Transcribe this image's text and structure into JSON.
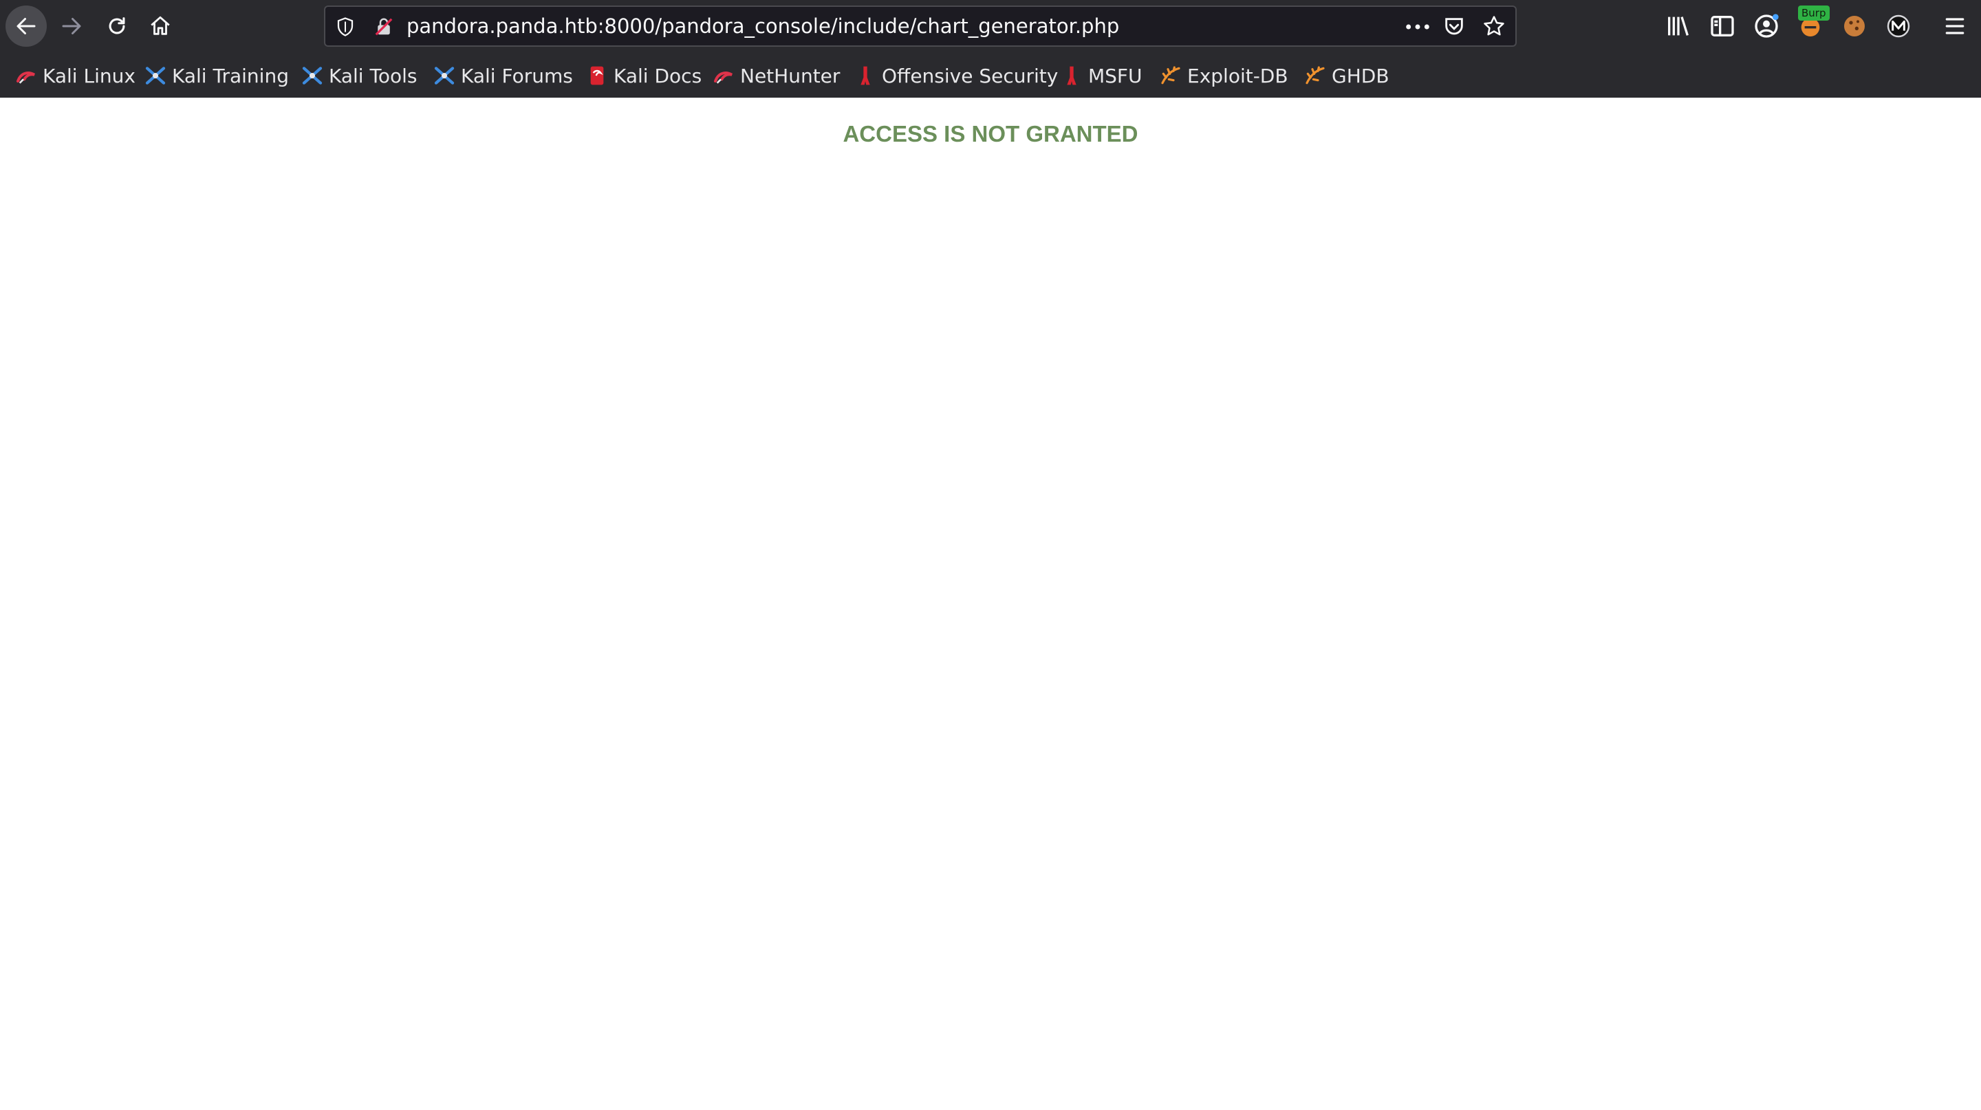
{
  "browser": {
    "url": "pandora.panda.htb:8000/pandora_console/include/chart_generator.php",
    "nav_icons": [
      "back-arrow-icon",
      "forward-arrow-icon",
      "reload-icon",
      "home-icon"
    ],
    "urlbar_icons": [
      "shield-icon",
      "insecure-lock-icon",
      "more-dots-icon",
      "pocket-icon",
      "bookmark-star-icon"
    ],
    "toolbar_icons": [
      "library-icon",
      "sidebar-icon",
      "account-icon",
      "burp-extension-icon",
      "cookie-extension-icon",
      "extension-m-icon",
      "hamburger-menu-icon"
    ],
    "burp_badge": "Burp"
  },
  "bookmarks": [
    {
      "label": "Kali Linux",
      "icon": "kali-dragon-icon"
    },
    {
      "label": "Kali Training",
      "icon": "kali-training-icon"
    },
    {
      "label": "Kali Tools",
      "icon": "kali-tools-icon"
    },
    {
      "label": "Kali Forums",
      "icon": "kali-forums-icon"
    },
    {
      "label": "Kali Docs",
      "icon": "kali-docs-icon"
    },
    {
      "label": "NetHunter",
      "icon": "nethunter-icon"
    },
    {
      "label": "Offensive Security",
      "icon": "offsec-icon"
    },
    {
      "label": "MSFU",
      "icon": "msfu-icon"
    },
    {
      "label": "Exploit-DB",
      "icon": "exploit-db-icon"
    },
    {
      "label": "GHDB",
      "icon": "ghdb-icon"
    }
  ],
  "page": {
    "message": "ACCESS IS NOT GRANTED",
    "message_color": "#6b8f5a"
  }
}
